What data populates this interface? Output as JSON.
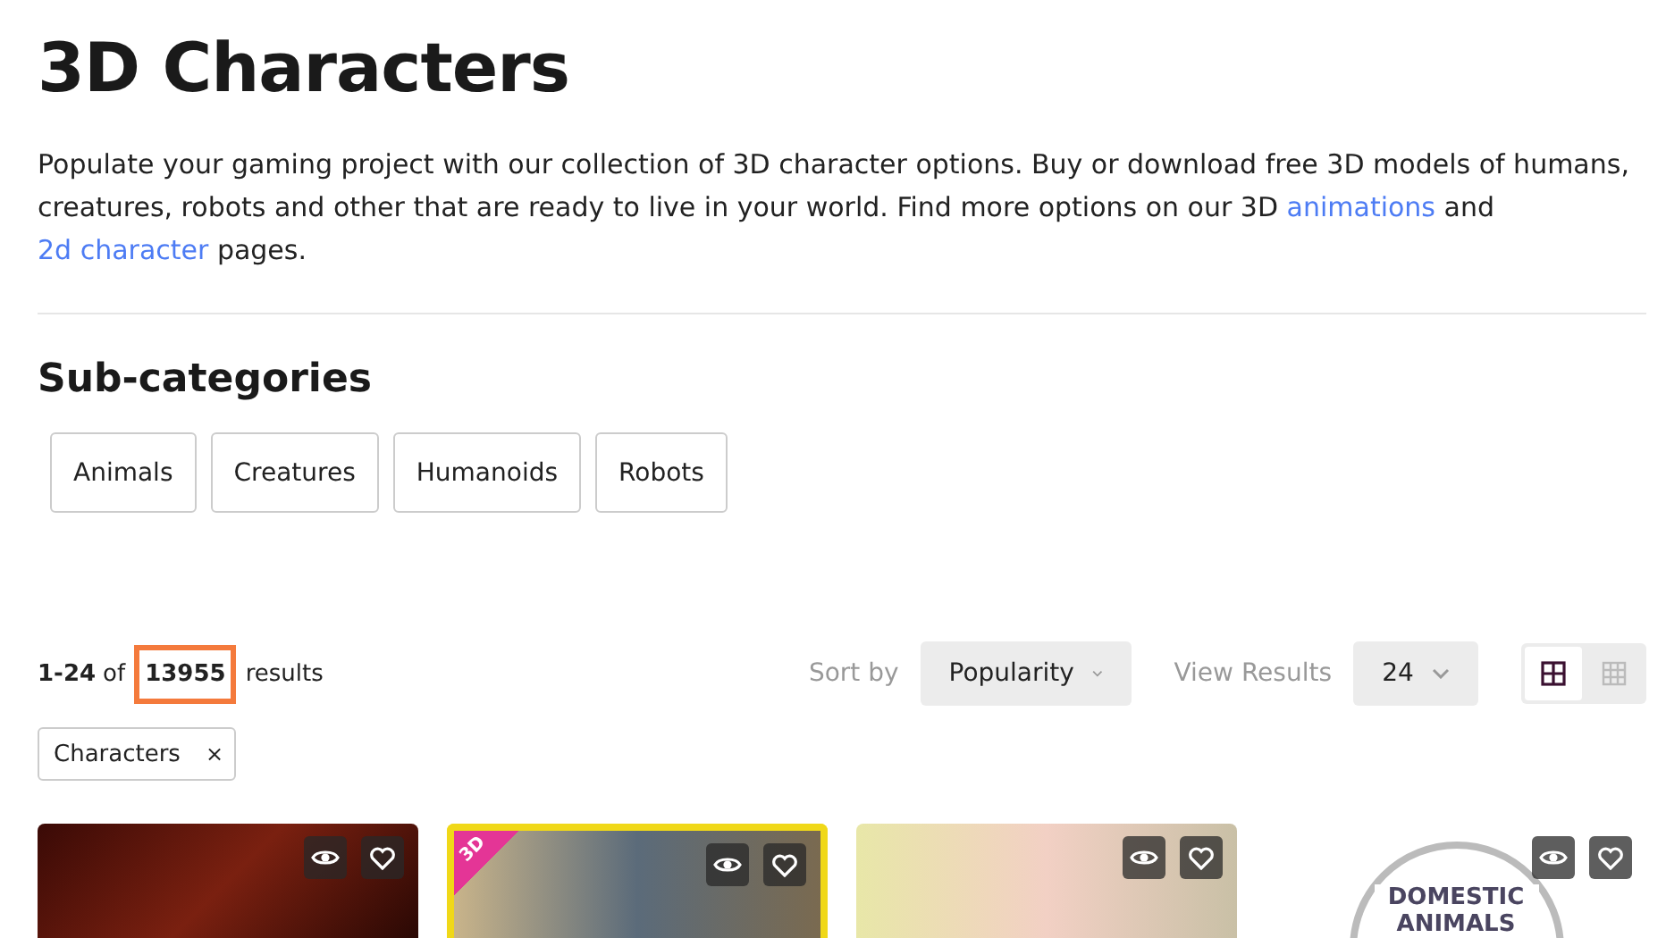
{
  "title": "3D Characters",
  "description": [
    {
      "kind": "text",
      "text": "Populate your gaming project with our collection of 3D character options. Buy or download free 3D models of humans, creatures, robots and other that are ready to live in your world. Find more options on our 3D "
    },
    {
      "kind": "link",
      "text": "animations"
    },
    {
      "kind": "text",
      "text": " and "
    },
    {
      "kind": "link",
      "text": "2d character"
    },
    {
      "kind": "text",
      "text": " pages."
    }
  ],
  "subcategories": {
    "title": "Sub-categories",
    "items": [
      "Animals",
      "Creatures",
      "Humanoids",
      "Robots"
    ]
  },
  "results": {
    "range": "1-24",
    "of": "of",
    "total": "13955",
    "suffix": "results",
    "total_highlighted": true
  },
  "sort": {
    "label": "Sort by",
    "value": "Popularity"
  },
  "view_results": {
    "label": "View Results",
    "value": "24"
  },
  "view_modes": [
    {
      "kind": "large-grid",
      "selected": true
    },
    {
      "kind": "small-grid",
      "selected": false
    }
  ],
  "filters": [
    {
      "label": "Characters",
      "remove": "×"
    }
  ],
  "cards": [
    {
      "featured": false,
      "kind": "dark"
    },
    {
      "featured": true,
      "badge": "3D",
      "kind": "comic"
    },
    {
      "featured": false,
      "kind": "pastel"
    },
    {
      "featured": false,
      "kind": "white",
      "caption": "DOMESTIC ANIMALS"
    }
  ]
}
